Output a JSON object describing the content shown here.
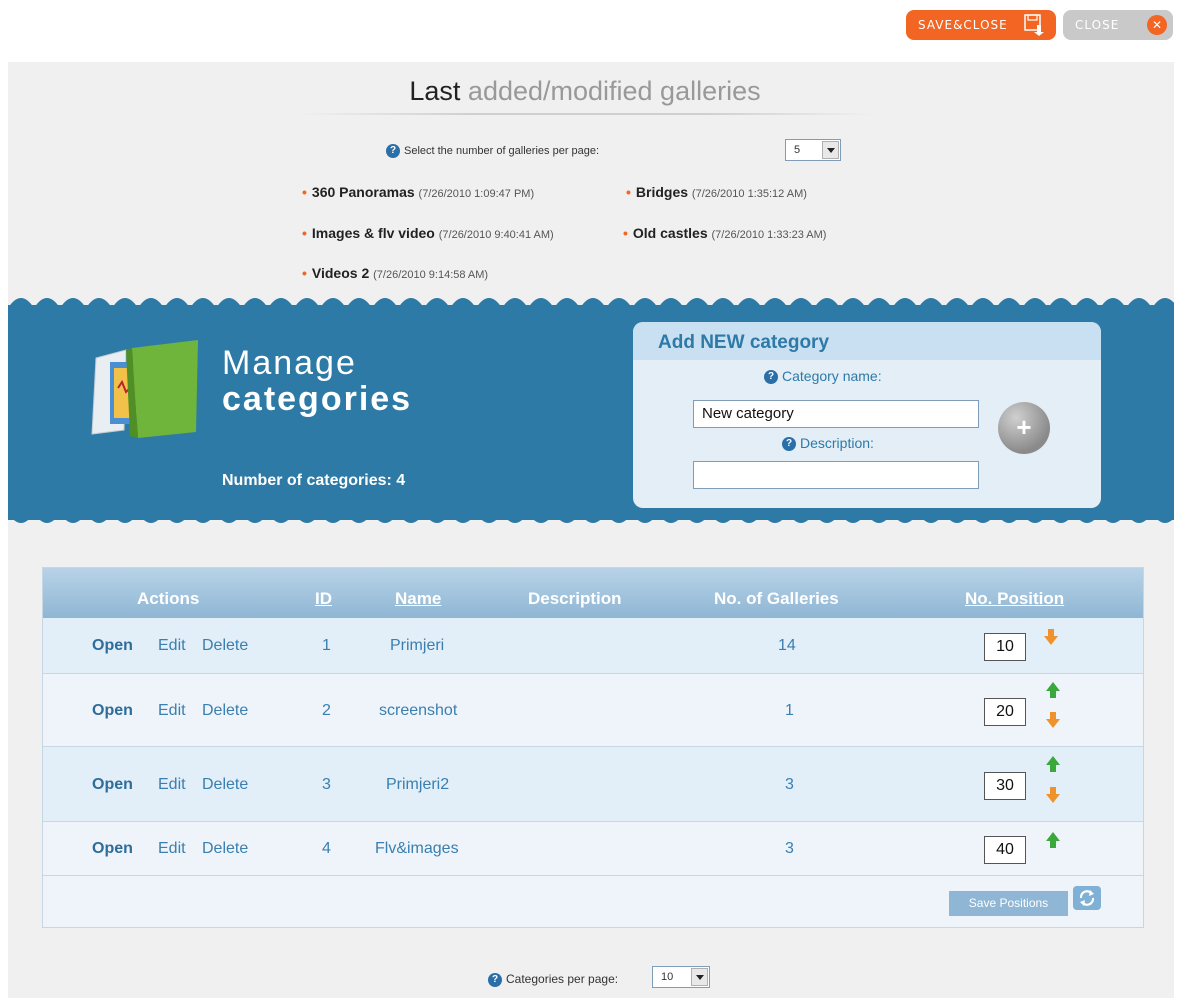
{
  "toolbar": {
    "save_close_label": "SAVE&CLOSE",
    "close_label": "CLOSE"
  },
  "last_galleries": {
    "title_bold": "Last",
    "title_rest": "added/modified galleries",
    "per_page_label": "Select the number of galleries per page:",
    "per_page_value": "5",
    "items": [
      {
        "name": "360 Panoramas",
        "date": "(7/26/2010 1:09:47 PM)"
      },
      {
        "name": "Bridges",
        "date": "(7/26/2010 1:35:12 AM)"
      },
      {
        "name": "Images & flv video",
        "date": "(7/26/2010 9:40:41 AM)"
      },
      {
        "name": "Old castles",
        "date": "(7/26/2010 1:33:23 AM)"
      },
      {
        "name": "Videos 2",
        "date": "(7/26/2010 9:14:58 AM)"
      }
    ]
  },
  "manage": {
    "title_line1": "Manage",
    "title_line2": "categories",
    "count_label": "Number of categories: 4"
  },
  "add_category": {
    "heading": "Add NEW category",
    "name_label": "Category name:",
    "name_value": "New category",
    "description_label": "Description:",
    "description_value": "",
    "add_symbol": "+"
  },
  "table": {
    "headers": {
      "actions": "Actions",
      "id": "ID",
      "name": "Name",
      "description": "Description",
      "galleries": "No. of Galleries",
      "position": "No. Position"
    },
    "action_labels": {
      "open": "Open",
      "edit": "Edit",
      "delete": "Delete"
    },
    "rows": [
      {
        "id": "1",
        "name": "Primjeri",
        "description": "",
        "galleries": "14",
        "position": "10",
        "up": false,
        "down": true
      },
      {
        "id": "2",
        "name": "screenshot",
        "description": "",
        "galleries": "1",
        "position": "20",
        "up": true,
        "down": true
      },
      {
        "id": "3",
        "name": "Primjeri2",
        "description": "",
        "galleries": "3",
        "position": "30",
        "up": true,
        "down": true
      },
      {
        "id": "4",
        "name": "Flv&images",
        "description": "",
        "galleries": "3",
        "position": "40",
        "up": true,
        "down": false
      }
    ],
    "save_positions_label": "Save Positions"
  },
  "footer": {
    "cats_per_page_label": "Categories per page:",
    "cats_per_page_value": "10"
  },
  "colors": {
    "accent": "#f26522",
    "banner": "#2e7aa6",
    "arrow_up": "#3aa83a",
    "arrow_down": "#f0922b"
  }
}
